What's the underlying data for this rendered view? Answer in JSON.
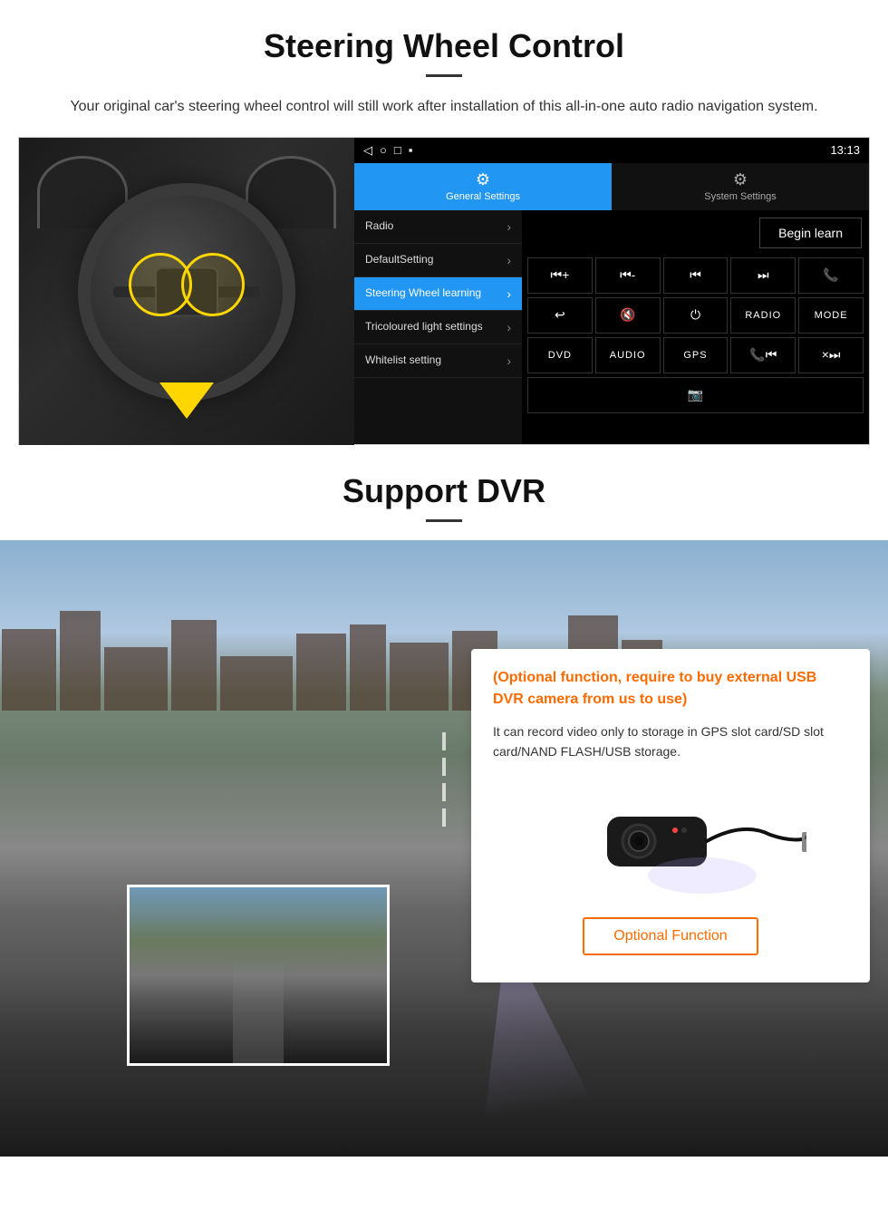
{
  "section1": {
    "title": "Steering Wheel Control",
    "subtitle": "Your original car's steering wheel control will still work after installation of this all-in-one auto radio navigation system.",
    "statusbar": {
      "icons": "◁  ○  □  ▪",
      "time": "13:13",
      "signal": "▾"
    },
    "tabs": {
      "general": {
        "label": "General Settings",
        "icon": "⚙"
      },
      "system": {
        "label": "System Settings",
        "icon": "🔧"
      }
    },
    "menu": [
      {
        "label": "Radio",
        "active": false
      },
      {
        "label": "DefaultSetting",
        "active": false
      },
      {
        "label": "Steering Wheel learning",
        "active": true
      },
      {
        "label": "Tricoloured light settings",
        "active": false
      },
      {
        "label": "Whitelist setting",
        "active": false
      }
    ],
    "begin_learn": "Begin learn",
    "controls": [
      [
        "⏮+",
        "⏮-",
        "⏮|",
        "|⏭",
        "📞"
      ],
      [
        "↩",
        "🔇×",
        "⏻",
        "RADIO",
        "MODE"
      ],
      [
        "DVD",
        "AUDIO",
        "GPS",
        "📞⏮",
        "×⏭"
      ],
      [
        "📷"
      ]
    ]
  },
  "section2": {
    "title": "Support DVR",
    "info_title": "(Optional function, require to buy external USB DVR camera from us to use)",
    "info_text": "It can record video only to storage in GPS slot card/SD slot card/NAND FLASH/USB storage.",
    "optional_function_label": "Optional Function"
  }
}
